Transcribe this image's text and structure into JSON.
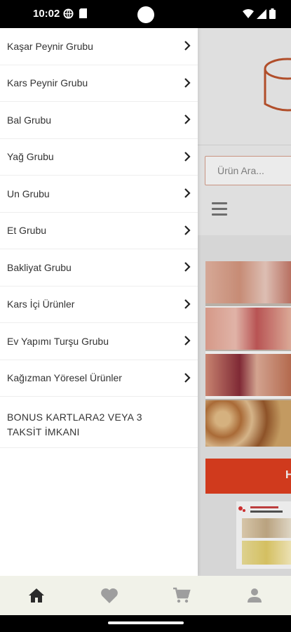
{
  "status_bar": {
    "time": "10:02",
    "icons": [
      "globe-icon",
      "sim-icon",
      "wifi-icon",
      "signal-icon",
      "battery-icon"
    ]
  },
  "background_page": {
    "search_placeholder": "Ürün Ara...",
    "red_button_label": "H",
    "accent_color": "#e23f20"
  },
  "drawer": {
    "items": [
      {
        "label": "Kaşar Peynir Grubu",
        "has_chevron": true
      },
      {
        "label": "Kars Peynir Grubu",
        "has_chevron": true
      },
      {
        "label": "Bal Grubu",
        "has_chevron": true
      },
      {
        "label": "Yağ Grubu",
        "has_chevron": true
      },
      {
        "label": "Un Grubu",
        "has_chevron": true
      },
      {
        "label": "Et Grubu",
        "has_chevron": true
      },
      {
        "label": "Bakliyat Grubu",
        "has_chevron": true
      },
      {
        "label": "Kars İçi Ürünler",
        "has_chevron": true
      },
      {
        "label": "Ev Yapımı Turşu Grubu",
        "has_chevron": true
      },
      {
        "label": "Kağızman Yöresel Ürünler",
        "has_chevron": true
      },
      {
        "label": "BONUS KARTLARA2 VEYA 3 TAKSİT İMKANI",
        "has_chevron": false
      }
    ]
  },
  "bottom_nav": {
    "items": [
      {
        "icon": "home-icon",
        "active": true
      },
      {
        "icon": "heart-icon",
        "active": false
      },
      {
        "icon": "cart-icon",
        "active": false
      },
      {
        "icon": "profile-icon",
        "active": false
      }
    ],
    "active_color": "#2b2b2b",
    "inactive_color": "#9e9e9e"
  }
}
